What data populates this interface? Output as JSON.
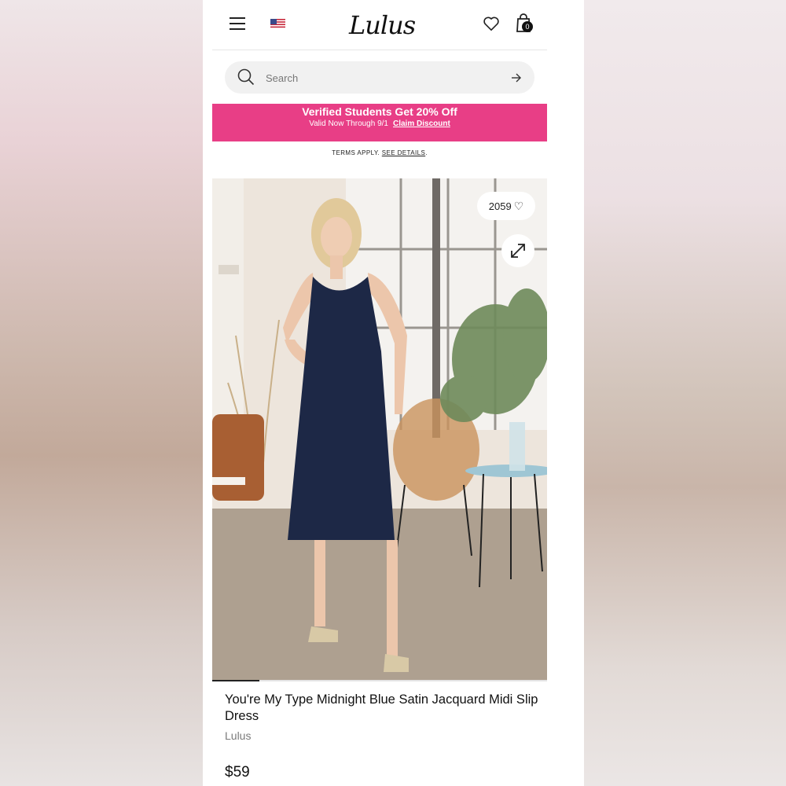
{
  "header": {
    "logo_text": "Lulus",
    "cart_count": "0"
  },
  "search": {
    "placeholder": "Search"
  },
  "promo": {
    "title": "Verified Students Get 20% Off",
    "subtitle": "Valid Now Through 9/1",
    "cta": "Claim Discount",
    "background_color": "#e83e86"
  },
  "terms": {
    "text": "TERMS APPLY.",
    "link": "SEE DETAILS",
    "suffix": "."
  },
  "product": {
    "likes_count": "2059",
    "name": "You're My Type Midnight Blue Satin Jacquard Midi Slip Dress",
    "brand": "Lulus",
    "price": "$59",
    "image_progress": 0.14
  },
  "icons": [
    "menu-icon",
    "us-flag-icon",
    "heart-icon",
    "shopping-bag-icon",
    "search-icon",
    "arrow-right-icon",
    "expand-icon"
  ]
}
